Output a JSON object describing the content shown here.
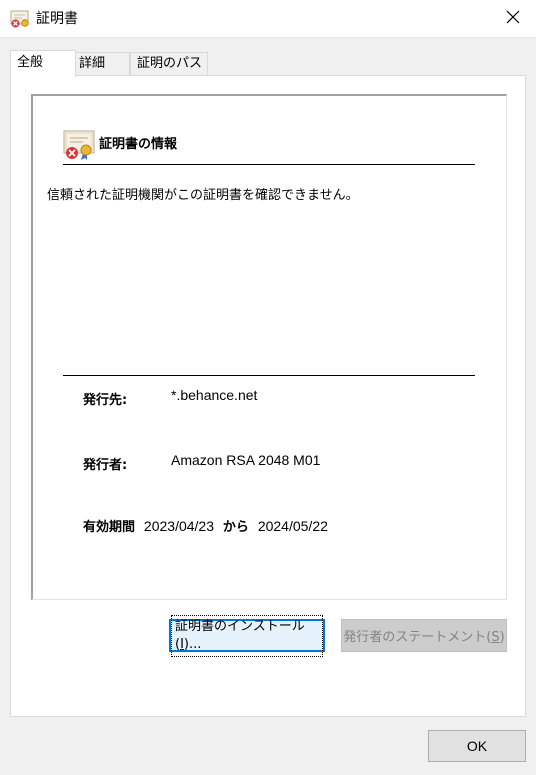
{
  "window": {
    "title": "証明書",
    "close_glyph": "✕"
  },
  "tabs": [
    {
      "label": "全般",
      "active": true
    },
    {
      "label": "詳細",
      "active": false
    },
    {
      "label": "証明のパス",
      "active": false
    }
  ],
  "general": {
    "heading": "証明書の情報",
    "warning": "信頼された証明機関がこの証明書を確認できません。",
    "issued_to_label": "発行先:",
    "issued_to_value": "*.behance.net",
    "issued_by_label": "発行者:",
    "issued_by_value": "Amazon RSA 2048 M01",
    "validity_label": "有効期間",
    "valid_from": "2023/04/23",
    "valid_sep": "から",
    "valid_to": "2024/05/22"
  },
  "buttons": {
    "install_prefix": "証明書のインストール(",
    "install_key": "I",
    "install_suffix": ")...",
    "statement_prefix": "発行者のステートメント(",
    "statement_key": "S",
    "statement_suffix": ")",
    "statement_enabled": false,
    "ok": "OK"
  },
  "icons": {
    "title_icon": "certificate-error-icon",
    "close_icon": "close-icon",
    "info_icon": "certificate-error-icon"
  },
  "colors": {
    "focus_border": "#0078d7",
    "button_face": "#e1e1e1",
    "disabled_text": "#838383"
  }
}
